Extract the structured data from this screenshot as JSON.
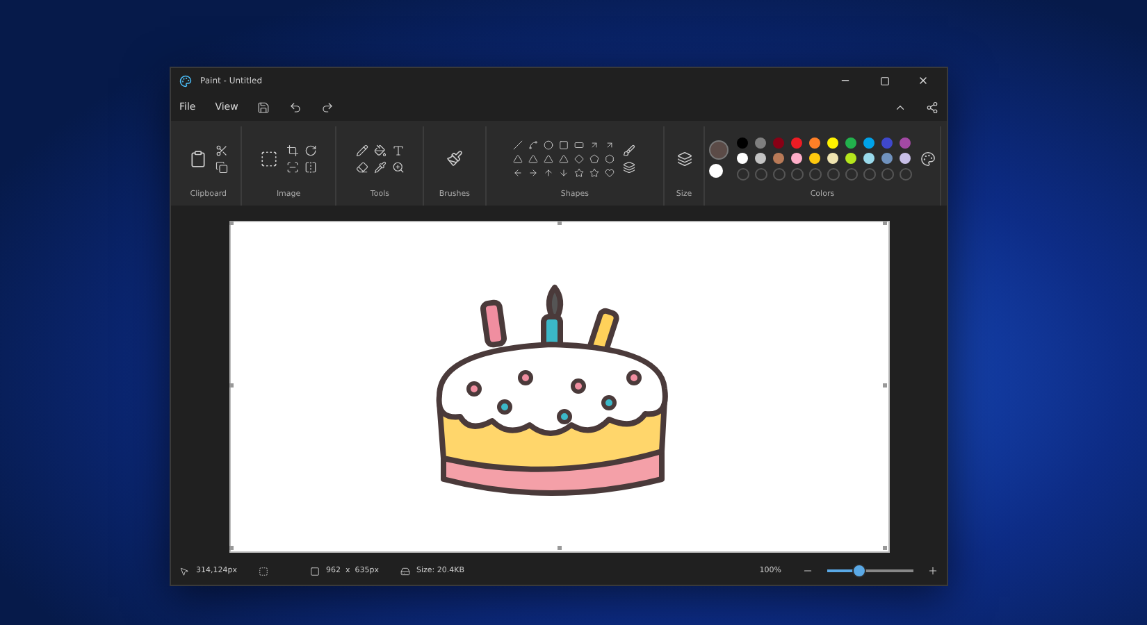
{
  "window": {
    "title": "Paint - Untitled"
  },
  "menu": [
    {
      "label": "File"
    },
    {
      "label": "View"
    }
  ],
  "ribbon_groups": [
    {
      "label": "Clipboard"
    },
    {
      "label": "Image"
    },
    {
      "label": "Tools"
    },
    {
      "label": "Brushes"
    },
    {
      "label": "Shapes"
    },
    {
      "label": "Size"
    },
    {
      "label": "Colors"
    }
  ],
  "colors": {
    "current": [
      {
        "color": "#5b4b47"
      },
      {
        "color": "#ffffff"
      }
    ],
    "palette": [
      {
        "color": "#000000"
      },
      {
        "color": "#7f7f7f"
      },
      {
        "color": "#880015"
      },
      {
        "color": "#ed1c24"
      },
      {
        "color": "#ff7f27"
      },
      {
        "color": "#fff200"
      },
      {
        "color": "#22b14c"
      },
      {
        "color": "#00a2e8"
      },
      {
        "color": "#3f48cc"
      },
      {
        "color": "#a349a4"
      },
      {
        "color": "#ffffff"
      },
      {
        "color": "#c3c3c3"
      },
      {
        "color": "#b97a57"
      },
      {
        "color": "#ffaec9"
      },
      {
        "color": "#ffc90e"
      },
      {
        "color": "#efe4b0"
      },
      {
        "color": "#b5e61d"
      },
      {
        "color": "#99d9ea"
      },
      {
        "color": "#7092be"
      },
      {
        "color": "#c8bfe7"
      }
    ]
  },
  "status_bar": {
    "cursor": "314,124px",
    "canvas_size": "962  x  635px",
    "file_size": "Size: 20.4KB",
    "zoom": "100%",
    "zoom_slider": {
      "level": 0.37
    }
  }
}
